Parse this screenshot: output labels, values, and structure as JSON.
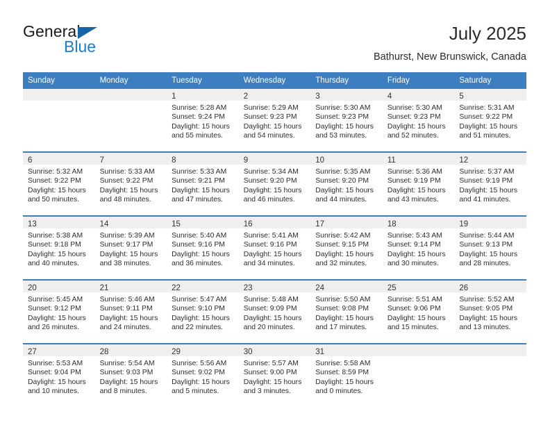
{
  "brand": {
    "line1": "General",
    "line2": "Blue",
    "triangle_icon": "brand-triangle-icon",
    "accent_dark": "#1565a8",
    "accent_blue": "#1a7ed1"
  },
  "header": {
    "title": "July 2025",
    "subtitle": "Bathurst, New Brunswick, Canada"
  },
  "colors": {
    "header_blue": "#3c7ebf",
    "daynum_band": "#efefef",
    "text": "#2d2d2d"
  },
  "calendar": {
    "weekday_headers": [
      "Sunday",
      "Monday",
      "Tuesday",
      "Wednesday",
      "Thursday",
      "Friday",
      "Saturday"
    ],
    "weeks": [
      [
        {
          "day": "",
          "lines": []
        },
        {
          "day": "",
          "lines": []
        },
        {
          "day": "1",
          "lines": [
            "Sunrise: 5:28 AM",
            "Sunset: 9:24 PM",
            "Daylight: 15 hours",
            "and 55 minutes."
          ]
        },
        {
          "day": "2",
          "lines": [
            "Sunrise: 5:29 AM",
            "Sunset: 9:23 PM",
            "Daylight: 15 hours",
            "and 54 minutes."
          ]
        },
        {
          "day": "3",
          "lines": [
            "Sunrise: 5:30 AM",
            "Sunset: 9:23 PM",
            "Daylight: 15 hours",
            "and 53 minutes."
          ]
        },
        {
          "day": "4",
          "lines": [
            "Sunrise: 5:30 AM",
            "Sunset: 9:23 PM",
            "Daylight: 15 hours",
            "and 52 minutes."
          ]
        },
        {
          "day": "5",
          "lines": [
            "Sunrise: 5:31 AM",
            "Sunset: 9:22 PM",
            "Daylight: 15 hours",
            "and 51 minutes."
          ]
        }
      ],
      [
        {
          "day": "6",
          "lines": [
            "Sunrise: 5:32 AM",
            "Sunset: 9:22 PM",
            "Daylight: 15 hours",
            "and 50 minutes."
          ]
        },
        {
          "day": "7",
          "lines": [
            "Sunrise: 5:33 AM",
            "Sunset: 9:22 PM",
            "Daylight: 15 hours",
            "and 48 minutes."
          ]
        },
        {
          "day": "8",
          "lines": [
            "Sunrise: 5:33 AM",
            "Sunset: 9:21 PM",
            "Daylight: 15 hours",
            "and 47 minutes."
          ]
        },
        {
          "day": "9",
          "lines": [
            "Sunrise: 5:34 AM",
            "Sunset: 9:20 PM",
            "Daylight: 15 hours",
            "and 46 minutes."
          ]
        },
        {
          "day": "10",
          "lines": [
            "Sunrise: 5:35 AM",
            "Sunset: 9:20 PM",
            "Daylight: 15 hours",
            "and 44 minutes."
          ]
        },
        {
          "day": "11",
          "lines": [
            "Sunrise: 5:36 AM",
            "Sunset: 9:19 PM",
            "Daylight: 15 hours",
            "and 43 minutes."
          ]
        },
        {
          "day": "12",
          "lines": [
            "Sunrise: 5:37 AM",
            "Sunset: 9:19 PM",
            "Daylight: 15 hours",
            "and 41 minutes."
          ]
        }
      ],
      [
        {
          "day": "13",
          "lines": [
            "Sunrise: 5:38 AM",
            "Sunset: 9:18 PM",
            "Daylight: 15 hours",
            "and 40 minutes."
          ]
        },
        {
          "day": "14",
          "lines": [
            "Sunrise: 5:39 AM",
            "Sunset: 9:17 PM",
            "Daylight: 15 hours",
            "and 38 minutes."
          ]
        },
        {
          "day": "15",
          "lines": [
            "Sunrise: 5:40 AM",
            "Sunset: 9:16 PM",
            "Daylight: 15 hours",
            "and 36 minutes."
          ]
        },
        {
          "day": "16",
          "lines": [
            "Sunrise: 5:41 AM",
            "Sunset: 9:16 PM",
            "Daylight: 15 hours",
            "and 34 minutes."
          ]
        },
        {
          "day": "17",
          "lines": [
            "Sunrise: 5:42 AM",
            "Sunset: 9:15 PM",
            "Daylight: 15 hours",
            "and 32 minutes."
          ]
        },
        {
          "day": "18",
          "lines": [
            "Sunrise: 5:43 AM",
            "Sunset: 9:14 PM",
            "Daylight: 15 hours",
            "and 30 minutes."
          ]
        },
        {
          "day": "19",
          "lines": [
            "Sunrise: 5:44 AM",
            "Sunset: 9:13 PM",
            "Daylight: 15 hours",
            "and 28 minutes."
          ]
        }
      ],
      [
        {
          "day": "20",
          "lines": [
            "Sunrise: 5:45 AM",
            "Sunset: 9:12 PM",
            "Daylight: 15 hours",
            "and 26 minutes."
          ]
        },
        {
          "day": "21",
          "lines": [
            "Sunrise: 5:46 AM",
            "Sunset: 9:11 PM",
            "Daylight: 15 hours",
            "and 24 minutes."
          ]
        },
        {
          "day": "22",
          "lines": [
            "Sunrise: 5:47 AM",
            "Sunset: 9:10 PM",
            "Daylight: 15 hours",
            "and 22 minutes."
          ]
        },
        {
          "day": "23",
          "lines": [
            "Sunrise: 5:48 AM",
            "Sunset: 9:09 PM",
            "Daylight: 15 hours",
            "and 20 minutes."
          ]
        },
        {
          "day": "24",
          "lines": [
            "Sunrise: 5:50 AM",
            "Sunset: 9:08 PM",
            "Daylight: 15 hours",
            "and 17 minutes."
          ]
        },
        {
          "day": "25",
          "lines": [
            "Sunrise: 5:51 AM",
            "Sunset: 9:06 PM",
            "Daylight: 15 hours",
            "and 15 minutes."
          ]
        },
        {
          "day": "26",
          "lines": [
            "Sunrise: 5:52 AM",
            "Sunset: 9:05 PM",
            "Daylight: 15 hours",
            "and 13 minutes."
          ]
        }
      ],
      [
        {
          "day": "27",
          "lines": [
            "Sunrise: 5:53 AM",
            "Sunset: 9:04 PM",
            "Daylight: 15 hours",
            "and 10 minutes."
          ]
        },
        {
          "day": "28",
          "lines": [
            "Sunrise: 5:54 AM",
            "Sunset: 9:03 PM",
            "Daylight: 15 hours",
            "and 8 minutes."
          ]
        },
        {
          "day": "29",
          "lines": [
            "Sunrise: 5:56 AM",
            "Sunset: 9:02 PM",
            "Daylight: 15 hours",
            "and 5 minutes."
          ]
        },
        {
          "day": "30",
          "lines": [
            "Sunrise: 5:57 AM",
            "Sunset: 9:00 PM",
            "Daylight: 15 hours",
            "and 3 minutes."
          ]
        },
        {
          "day": "31",
          "lines": [
            "Sunrise: 5:58 AM",
            "Sunset: 8:59 PM",
            "Daylight: 15 hours",
            "and 0 minutes."
          ]
        },
        {
          "day": "",
          "lines": []
        },
        {
          "day": "",
          "lines": []
        }
      ]
    ]
  }
}
